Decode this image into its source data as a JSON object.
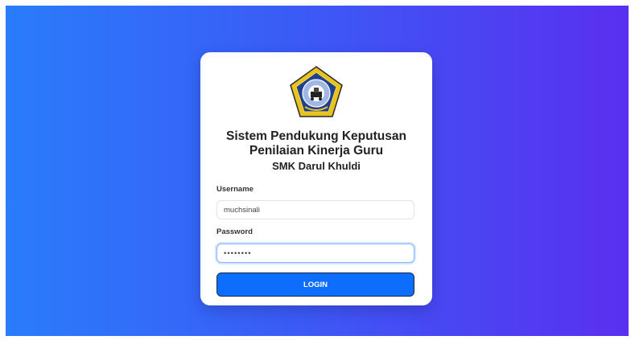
{
  "app": {
    "title_line1": "Sistem Pendukung Keputusan",
    "title_line2": "Penilaian Kinerja Guru",
    "title_line3": "SMK Darul Khuldi"
  },
  "logo": {
    "icon": "school-emblem-icon",
    "colors": {
      "outer": "#e8c21e",
      "inner": "#1f3f8f",
      "border": "#2a2a2a"
    }
  },
  "form": {
    "username_label": "Username",
    "username_value": "muchsinali",
    "password_label": "Password",
    "password_value": "••••••••",
    "login_label": "LOGIN"
  },
  "colors": {
    "bg_start": "#2a7cfb",
    "bg_end": "#5a2ff0",
    "button": "#0d6efd"
  }
}
